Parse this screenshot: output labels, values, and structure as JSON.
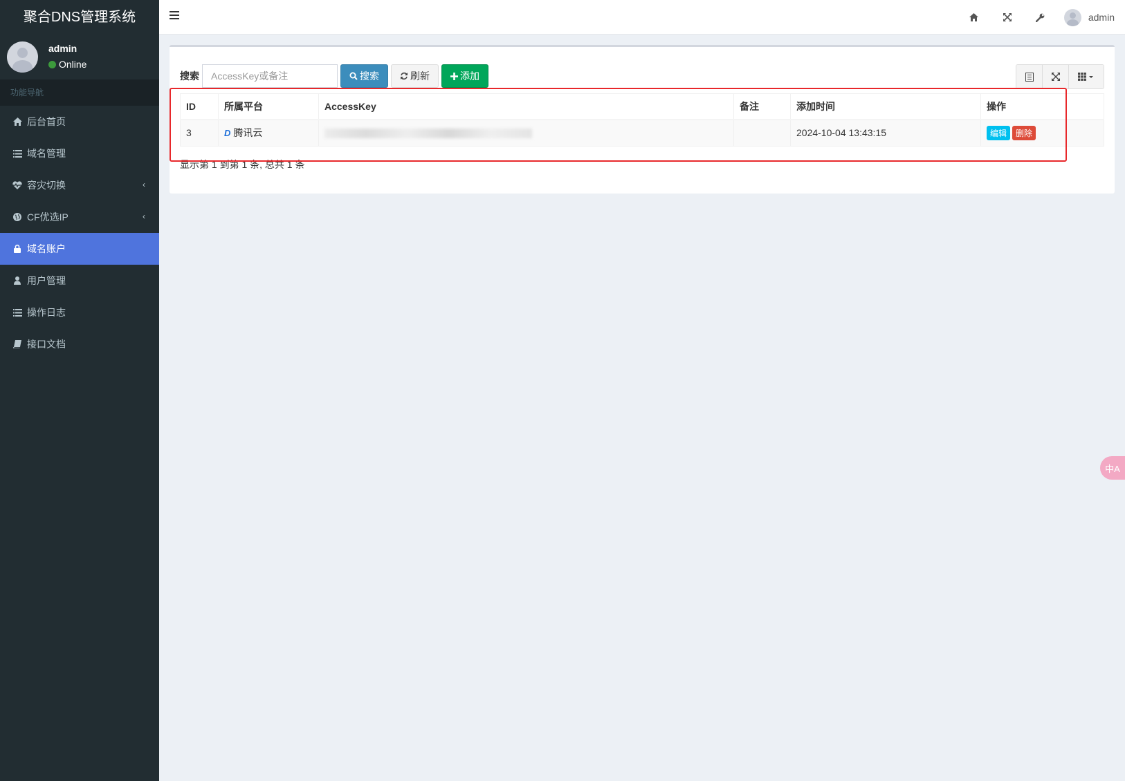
{
  "app": {
    "title": "聚合DNS管理系统"
  },
  "user_panel": {
    "name": "admin",
    "status": "Online"
  },
  "sidebar": {
    "header": "功能导航",
    "items": [
      {
        "label": "后台首页",
        "icon": "home-icon"
      },
      {
        "label": "域名管理",
        "icon": "list-icon"
      },
      {
        "label": "容灾切换",
        "icon": "heartbeat-icon",
        "has_submenu": true
      },
      {
        "label": "CF优选IP",
        "icon": "globe-icon",
        "has_submenu": true
      },
      {
        "label": "域名账户",
        "icon": "lock-icon",
        "active": true
      },
      {
        "label": "用户管理",
        "icon": "user-icon"
      },
      {
        "label": "操作日志",
        "icon": "list-icon"
      },
      {
        "label": "接口文档",
        "icon": "book-icon"
      }
    ]
  },
  "topbar": {
    "username": "admin",
    "icons": [
      "home-icon",
      "fullscreen-icon",
      "wrench-icon"
    ]
  },
  "toolbar": {
    "search_label": "搜索",
    "search_placeholder": "AccessKey或备注",
    "search_value": "",
    "search_button": "搜索",
    "refresh_button": "刷新",
    "add_button": "添加"
  },
  "table": {
    "columns": [
      "ID",
      "所属平台",
      "AccessKey",
      "备注",
      "添加时间",
      "操作"
    ],
    "rows": [
      {
        "id": "3",
        "platform": "腾讯云",
        "accesskey": "",
        "remark": "",
        "created": "2024-10-04 13:43:15",
        "edit": "编辑",
        "delete": "删除"
      }
    ]
  },
  "pagination": {
    "summary": "显示第 1 到第 1 条, 总共 1 条"
  },
  "translate_fab": {
    "label": "中A"
  },
  "colors": {
    "sidebar": "#222d32",
    "active": "#4f74dd",
    "primary": "#3c8dbc",
    "success": "#00a65a",
    "danger": "#dd4b39",
    "info": "#00c0ef",
    "highlight": "#e8282b"
  }
}
